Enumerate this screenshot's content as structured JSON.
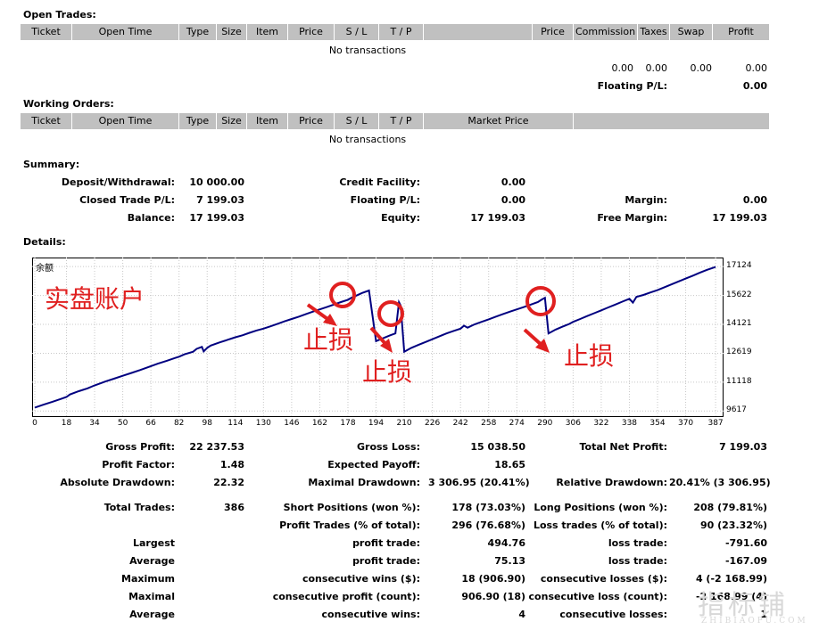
{
  "open_trades": {
    "title": "Open Trades:",
    "columns": [
      "Ticket",
      "Open Time",
      "Type",
      "Size",
      "Item",
      "Price",
      "S / L",
      "T / P",
      "",
      "Price",
      "Commission",
      "Taxes",
      "Swap",
      "Profit"
    ],
    "empty_text": "No transactions",
    "totals": {
      "commission": "0.00",
      "taxes": "0.00",
      "swap": "0.00",
      "profit": "0.00"
    },
    "floating_label": "Floating P/L:",
    "floating_value": "0.00"
  },
  "working_orders": {
    "title": "Working Orders:",
    "columns": [
      "Ticket",
      "Open Time",
      "Type",
      "Size",
      "Item",
      "Price",
      "S / L",
      "T / P",
      "Market Price"
    ],
    "empty_text": "No transactions"
  },
  "summary": {
    "title": "Summary:",
    "deposit_label": "Deposit/Withdrawal:",
    "deposit_value": "10 000.00",
    "credit_label": "Credit Facility:",
    "credit_value": "0.00",
    "closed_label": "Closed Trade P/L:",
    "closed_value": "7 199.03",
    "floating_label": "Floating P/L:",
    "floating_value": "0.00",
    "margin_label": "Margin:",
    "margin_value": "0.00",
    "balance_label": "Balance:",
    "balance_value": "17 199.03",
    "equity_label": "Equity:",
    "equity_value": "17 199.03",
    "free_margin_label": "Free Margin:",
    "free_margin_value": "17 199.03"
  },
  "details_title": "Details:",
  "chart_data": {
    "type": "line",
    "title": "",
    "legend_label": "余额",
    "x_ticks": [
      0,
      18,
      34,
      50,
      66,
      82,
      98,
      114,
      130,
      146,
      162,
      178,
      194,
      210,
      226,
      242,
      258,
      274,
      290,
      306,
      322,
      338,
      354,
      370,
      387
    ],
    "y_ticks": [
      9617,
      11118,
      12619,
      14121,
      15622,
      17124
    ],
    "xlim": [
      0,
      390
    ],
    "ylim": [
      9400,
      17500
    ],
    "grid": true,
    "series": [
      {
        "color": "#000080",
        "x": [
          0,
          5,
          10,
          15,
          18,
          20,
          25,
          30,
          34,
          38,
          40,
          45,
          50,
          55,
          60,
          66,
          70,
          75,
          80,
          82,
          85,
          90,
          92,
          95,
          96,
          98,
          100,
          105,
          110,
          114,
          118,
          122,
          126,
          130,
          134,
          138,
          142,
          146,
          150,
          154,
          158,
          162,
          166,
          170,
          174,
          178,
          180,
          183,
          186,
          190,
          194,
          198,
          202,
          205,
          207,
          208,
          210,
          214,
          218,
          222,
          226,
          230,
          234,
          238,
          242,
          244,
          246,
          250,
          254,
          258,
          262,
          266,
          270,
          274,
          278,
          282,
          286,
          288,
          290,
          292,
          296,
          300,
          304,
          306,
          310,
          314,
          318,
          322,
          326,
          330,
          334,
          338,
          340,
          342,
          346,
          350,
          354,
          358,
          362,
          366,
          370,
          374,
          378,
          382,
          387
        ],
        "y": [
          9800,
          9950,
          10100,
          10250,
          10350,
          10480,
          10650,
          10800,
          10950,
          11080,
          11150,
          11300,
          11450,
          11600,
          11750,
          11950,
          12080,
          12230,
          12380,
          12440,
          12560,
          12700,
          12850,
          12950,
          12720,
          12900,
          13020,
          13180,
          13330,
          13450,
          13550,
          13680,
          13800,
          13900,
          14020,
          14150,
          14280,
          14400,
          14520,
          14650,
          14780,
          14900,
          15020,
          15150,
          15280,
          15400,
          15500,
          15620,
          15750,
          15880,
          13250,
          13400,
          13550,
          13650,
          15270,
          15100,
          12700,
          12900,
          13050,
          13200,
          13350,
          13500,
          13650,
          13780,
          13900,
          14050,
          13950,
          14120,
          14250,
          14380,
          14520,
          14650,
          14780,
          14900,
          15020,
          15150,
          15280,
          15400,
          15500,
          13650,
          13850,
          14000,
          14150,
          14250,
          14400,
          14550,
          14700,
          14850,
          15000,
          15150,
          15300,
          15450,
          15250,
          15550,
          15650,
          15780,
          15900,
          16050,
          16200,
          16350,
          16500,
          16650,
          16800,
          16950,
          17100
        ]
      }
    ]
  },
  "annotations": {
    "live": "实盘账户",
    "sl1": "止损",
    "sl2": "止损",
    "sl3": "止损"
  },
  "stats": {
    "gross_profit_label": "Gross Profit:",
    "gross_profit_value": "22 237.53",
    "gross_loss_label": "Gross Loss:",
    "gross_loss_value": "15 038.50",
    "net_profit_label": "Total Net Profit:",
    "net_profit_value": "7 199.03",
    "profit_factor_label": "Profit Factor:",
    "profit_factor_value": "1.48",
    "expected_payoff_label": "Expected Payoff:",
    "expected_payoff_value": "18.65",
    "abs_dd_label": "Absolute Drawdown:",
    "abs_dd_value": "22.32",
    "max_dd_label": "Maximal Drawdown:",
    "max_dd_value": "3 306.95 (20.41%)",
    "rel_dd_label": "Relative Drawdown:",
    "rel_dd_value": "20.41% (3 306.95)",
    "total_trades_label": "Total Trades:",
    "total_trades_value": "386",
    "short_label": "Short Positions (won %):",
    "short_value": "178 (73.03%)",
    "long_label": "Long Positions (won %):",
    "long_value": "208 (79.81%)",
    "profit_trades_label": "Profit Trades (% of total):",
    "profit_trades_value": "296 (76.68%)",
    "loss_trades_label": "Loss trades (% of total):",
    "loss_trades_value": "90 (23.32%)",
    "largest_label": "Largest",
    "largest_profit_label": "profit trade:",
    "largest_profit_value": "494.76",
    "largest_loss_label": "loss trade:",
    "largest_loss_value": "-791.60",
    "average_label": "Average",
    "avg_profit_label": "profit trade:",
    "avg_profit_value": "75.13",
    "avg_loss_label": "loss trade:",
    "avg_loss_value": "-167.09",
    "maximum_label": "Maximum",
    "max_cons_wins_label": "consecutive wins ($):",
    "max_cons_wins_value": "18 (906.90)",
    "max_cons_losses_label": "consecutive losses ($):",
    "max_cons_losses_value": "4 (-2 168.99)",
    "maximal_label": "Maximal",
    "maximal_profit_label": "consecutive profit (count):",
    "maximal_profit_value": "906.90 (18)",
    "maximal_loss_label": "consecutive loss (count):",
    "maximal_loss_value": "-2 168.99 (4)",
    "average2_label": "Average",
    "avg_cons_wins_label": "consecutive wins:",
    "avg_cons_wins_value": "4",
    "avg_cons_losses_label": "consecutive losses:",
    "avg_cons_losses_value": "1"
  },
  "watermark": {
    "main": "指标铺",
    "sub": "ZHIBIAOPU.COM"
  }
}
